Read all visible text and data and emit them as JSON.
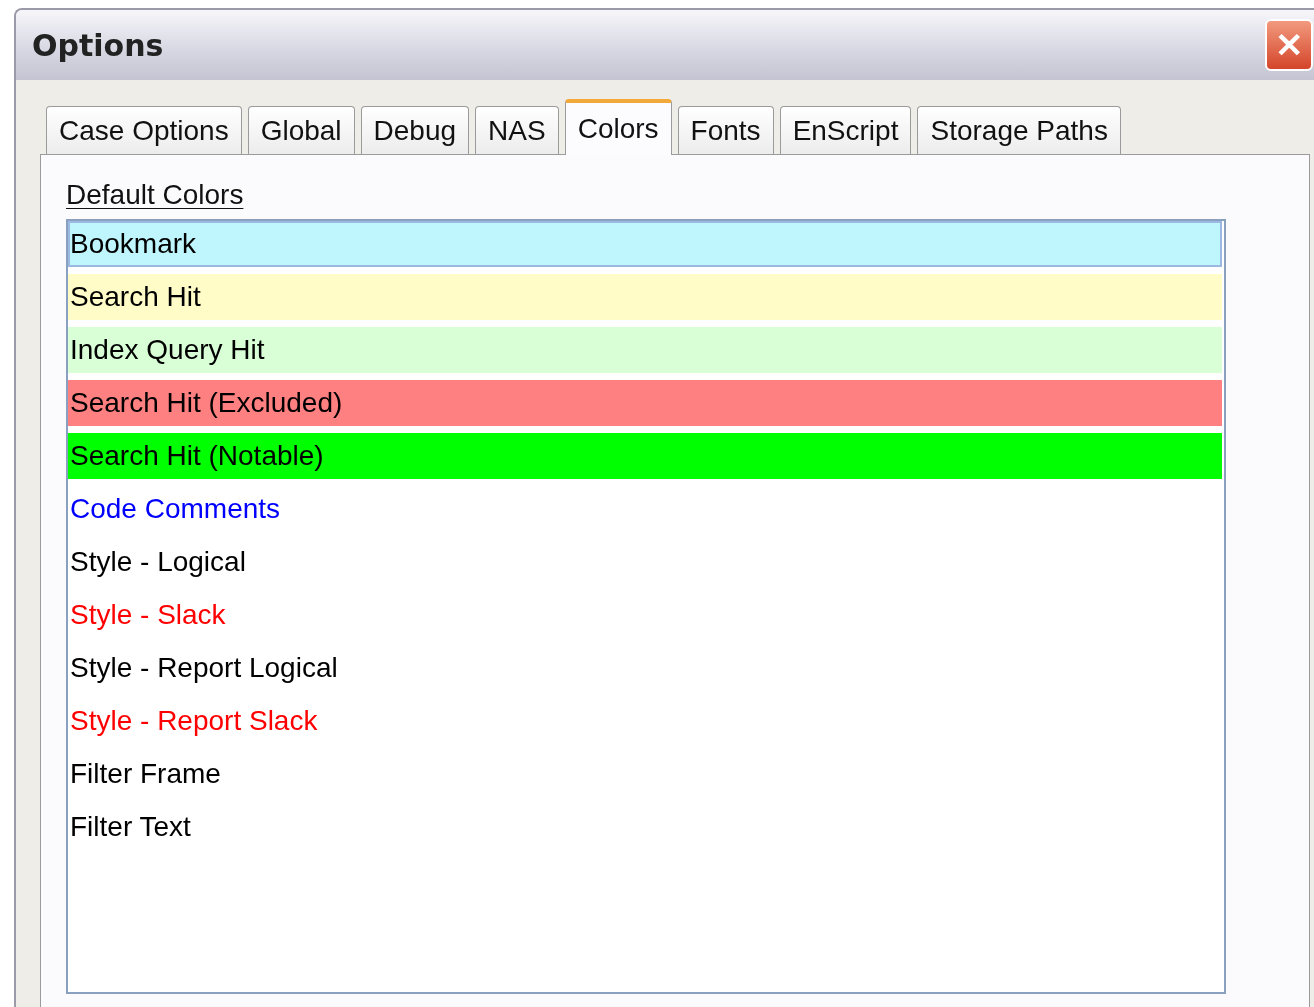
{
  "window": {
    "title": "Options",
    "close": "✕"
  },
  "tabs": [
    {
      "label": "Case Options",
      "selected": false
    },
    {
      "label": "Global",
      "selected": false
    },
    {
      "label": "Debug",
      "selected": false
    },
    {
      "label": "NAS",
      "selected": false
    },
    {
      "label": "Colors",
      "selected": true
    },
    {
      "label": "Fonts",
      "selected": false
    },
    {
      "label": "EnScript",
      "selected": false
    },
    {
      "label": "Storage Paths",
      "selected": false
    }
  ],
  "default_colors": {
    "label": "Default Colors",
    "items": [
      {
        "name": "Bookmark",
        "kind": "background",
        "color": "#bff5fd",
        "selected": true
      },
      {
        "name": "Search Hit",
        "kind": "background",
        "color": "#fffcc8",
        "selected": false
      },
      {
        "name": "Index Query Hit",
        "kind": "background",
        "color": "#d9ffd6",
        "selected": false
      },
      {
        "name": "Search Hit (Excluded)",
        "kind": "background",
        "color": "#ff8080",
        "selected": false
      },
      {
        "name": "Search Hit (Notable)",
        "kind": "background",
        "color": "#00ff00",
        "selected": false
      },
      {
        "name": "Code Comments",
        "kind": "text",
        "color": "#0000ff",
        "selected": false
      },
      {
        "name": "Style - Logical",
        "kind": "text",
        "color": "#000000",
        "selected": false
      },
      {
        "name": "Style - Slack",
        "kind": "text",
        "color": "#ff0000",
        "selected": false
      },
      {
        "name": "Style - Report Logical",
        "kind": "text",
        "color": "#000000",
        "selected": false
      },
      {
        "name": "Style - Report Slack",
        "kind": "text",
        "color": "#ff0000",
        "selected": false
      },
      {
        "name": "Filter Frame",
        "kind": "text",
        "color": "#000000",
        "selected": false
      },
      {
        "name": "Filter Text",
        "kind": "text",
        "color": "#000000",
        "selected": false
      }
    ]
  }
}
